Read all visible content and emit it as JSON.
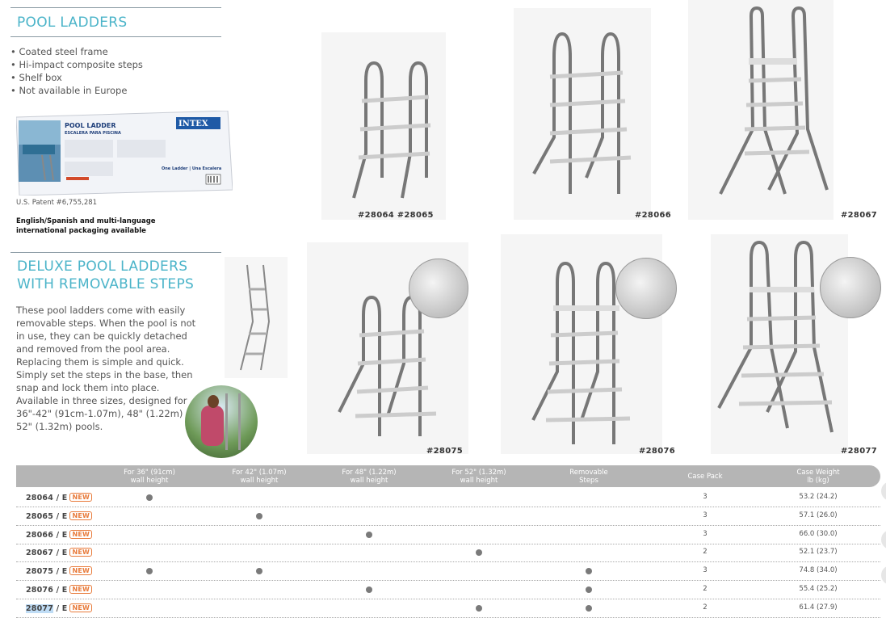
{
  "pool_ladders": {
    "title": "POOL LADDERS",
    "bullets": [
      "Coated steel frame",
      "Hi-impact composite steps",
      "Shelf box",
      "Not available in Europe"
    ],
    "box": {
      "heading": "POOL LADDER",
      "subheading": "ESCALERA PARA PISCINA",
      "brand": "INTEX",
      "caption": "One Ladder | Una Escalera"
    },
    "patent": "U.S. Patent #6,755,281",
    "packaging": "English/Spanish and multi-language international packaging available"
  },
  "deluxe": {
    "title_line1": "DELUXE POOL LADDERS",
    "title_line2": "WITH REMOVABLE STEPS",
    "description": "These pool ladders come with easily removable steps. When the pool is not in use, they can be quickly detached and removed from the pool area. Replacing them is simple and quick. Simply set the steps in the base, then snap and lock them into place. Available in three sizes, designed for 36\"-42\" (91cm-1.07m), 48\" (1.22m) and 52\" (1.32m) pools."
  },
  "products": {
    "p1": "#28064  #28065",
    "p2": "#28066",
    "p3": "#28067",
    "p4": "#28075",
    "p5": "#28076",
    "p6": "#28077"
  },
  "table": {
    "headers": [
      "For 36\" (91cm) wall height",
      "For 42\" (1.07m) wall height",
      "For 48\" (1.22m) wall height",
      "For 52\" (1.32m) wall height",
      "Removable Steps",
      "Case Pack",
      "Case Weight lb (kg)"
    ],
    "header_lines": [
      [
        "For 36\" (91cm)",
        "wall height"
      ],
      [
        "For 42\" (1.07m)",
        "wall height"
      ],
      [
        "For 48\" (1.22m)",
        "wall height"
      ],
      [
        "For 52\" (1.32m)",
        "wall height"
      ],
      [
        "Removable",
        "Steps"
      ],
      [
        "Case Pack",
        ""
      ],
      [
        "Case Weight",
        "lb (kg)"
      ]
    ],
    "badge": "NEW",
    "rows": [
      {
        "code": "28064",
        "suffix": " / E",
        "wall": [
          true,
          false,
          false,
          false
        ],
        "removable": false,
        "pack": "3",
        "weight": "53.2 (24.2)"
      },
      {
        "code": "28065",
        "suffix": " / E",
        "wall": [
          false,
          true,
          false,
          false
        ],
        "removable": false,
        "pack": "3",
        "weight": "57.1 (26.0)"
      },
      {
        "code": "28066",
        "suffix": " / E",
        "wall": [
          false,
          false,
          true,
          false
        ],
        "removable": false,
        "pack": "3",
        "weight": "66.0 (30.0)"
      },
      {
        "code": "28067",
        "suffix": " / E",
        "wall": [
          false,
          false,
          false,
          true
        ],
        "removable": false,
        "pack": "2",
        "weight": "52.1 (23.7)"
      },
      {
        "code": "28075",
        "suffix": " / E",
        "wall": [
          true,
          true,
          false,
          false
        ],
        "removable": true,
        "pack": "3",
        "weight": "74.8 (34.0)"
      },
      {
        "code": "28076",
        "suffix": " / E",
        "wall": [
          false,
          false,
          true,
          false
        ],
        "removable": true,
        "pack": "2",
        "weight": "55.4 (25.2)"
      },
      {
        "code": "28077",
        "suffix": " / E",
        "wall": [
          false,
          false,
          false,
          true
        ],
        "removable": true,
        "pack": "2",
        "weight": "61.4 (27.9)"
      }
    ]
  },
  "colors": {
    "accent": "#4bb4c9",
    "badge": "#e87a3a",
    "header": "#b5b5b5",
    "selection": "#bfdcf5"
  }
}
